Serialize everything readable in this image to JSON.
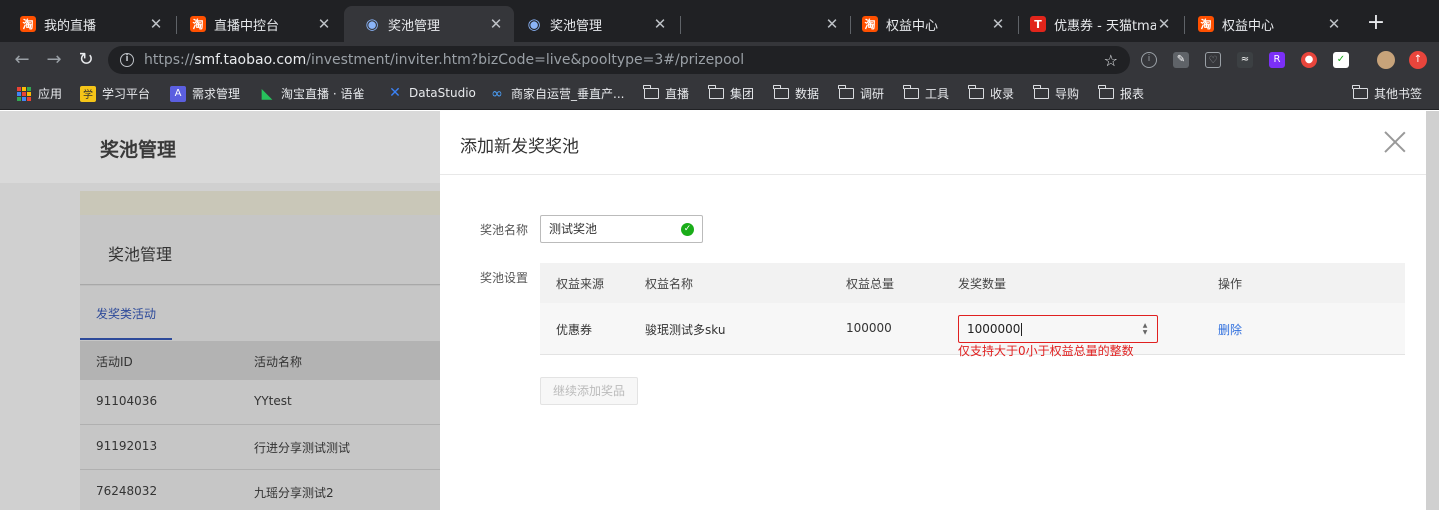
{
  "browser": {
    "tabs": [
      {
        "title": "我的直播",
        "favicon": "taobao-icon",
        "active": false
      },
      {
        "title": "直播中控台",
        "favicon": "taobao-icon",
        "active": false
      },
      {
        "title": "奖池管理",
        "favicon": "swirl-icon",
        "active": true
      },
      {
        "title": "奖池管理",
        "favicon": "swirl-icon",
        "active": false
      },
      {
        "title": "",
        "favicon": "",
        "active": false
      },
      {
        "title": "权益中心",
        "favicon": "taobao-icon",
        "active": false
      },
      {
        "title": "优惠券 - 天猫tmall",
        "favicon": "tmall-icon",
        "active": false
      },
      {
        "title": "权益中心",
        "favicon": "taobao-icon",
        "active": false
      }
    ],
    "url_scheme": "https://",
    "url_host": "smf.taobao.com",
    "url_path": "/investment/inviter.htm?bizCode=live&pooltype=3#/prizepool",
    "bookmarks": [
      {
        "label": "应用",
        "icon": "apps-grid-icon"
      },
      {
        "label": "学习平台",
        "icon": "learn-icon"
      },
      {
        "label": "需求管理",
        "icon": "a-letter-icon"
      },
      {
        "label": "淘宝直播 · 语雀",
        "icon": "yuque-icon"
      },
      {
        "label": "DataStudio",
        "icon": "datastudio-icon"
      },
      {
        "label": "商家自运营_垂直产...",
        "icon": "infinity-icon"
      },
      {
        "label": "直播",
        "icon": "folder-icon"
      },
      {
        "label": "集团",
        "icon": "folder-icon"
      },
      {
        "label": "数据",
        "icon": "folder-icon"
      },
      {
        "label": "调研",
        "icon": "folder-icon"
      },
      {
        "label": "工具",
        "icon": "folder-icon"
      },
      {
        "label": "收录",
        "icon": "folder-icon"
      },
      {
        "label": "导购",
        "icon": "folder-icon"
      },
      {
        "label": "报表",
        "icon": "folder-icon"
      }
    ],
    "other_bookmarks": "其他书签",
    "favicon_text": {
      "taobao": "淘",
      "tmall": "T"
    }
  },
  "background": {
    "page_title": "奖池管理",
    "card_title": "奖池管理",
    "tab_label": "发奖类活动",
    "columns": [
      "活动ID",
      "活动名称"
    ],
    "rows": [
      [
        "91104036",
        "YYtest"
      ],
      [
        "91192013",
        "行进分享测试测试"
      ],
      [
        "76248032",
        "九瑶分享测试2"
      ]
    ]
  },
  "drawer": {
    "title": "添加新发奖奖池",
    "name_label": "奖池名称",
    "name_value": "测试奖池",
    "settings_label": "奖池设置",
    "columns": [
      "权益来源",
      "权益名称",
      "权益总量",
      "发奖数量",
      "操作"
    ],
    "row": {
      "source": "优惠券",
      "name": "骏珉测试多sku",
      "total": "100000",
      "quantity": "1000000",
      "action": "删除"
    },
    "error": "仅支持大于0小于权益总量的整数",
    "add_button": "继续添加奖品"
  },
  "colors": {
    "accent": "#2f6fde",
    "error": "#e02020",
    "success": "#1aad19",
    "taobao": "#ff5000"
  }
}
